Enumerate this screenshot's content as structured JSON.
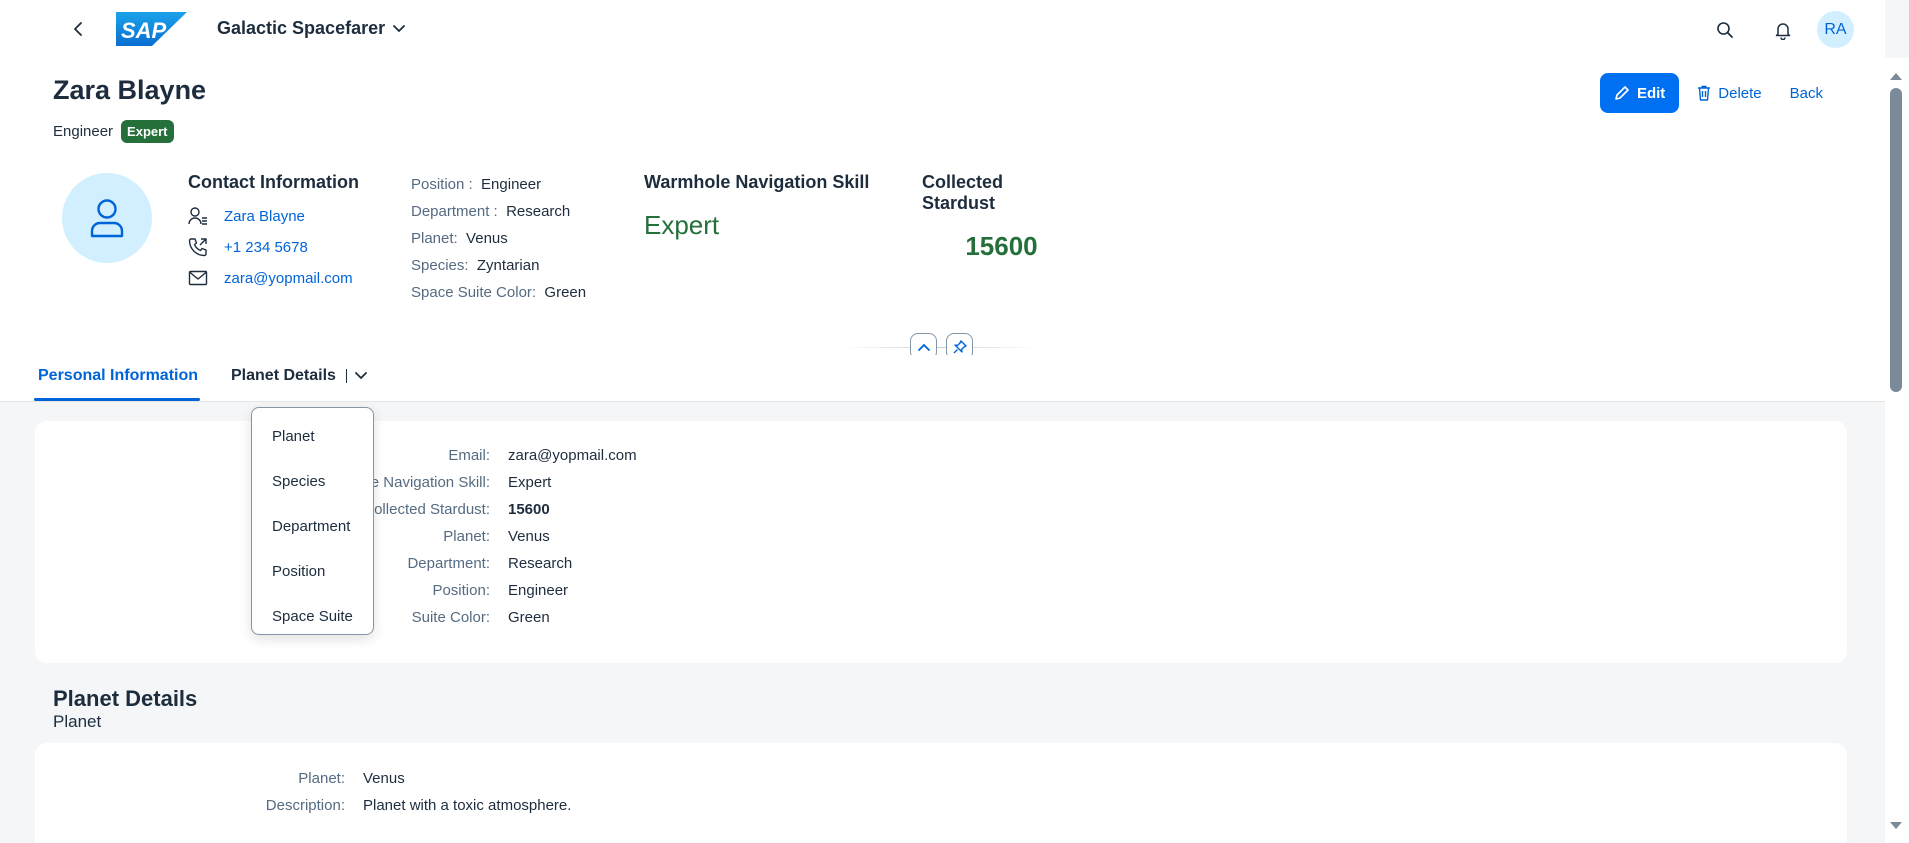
{
  "shell": {
    "app_title": "Galactic Spacefarer",
    "logo_text": "SAP",
    "user_initials": "RA"
  },
  "header": {
    "title": "Zara Blayne",
    "subtitle": "Engineer",
    "badge": "Expert",
    "actions": {
      "edit": "Edit",
      "delete": "Delete",
      "back": "Back"
    }
  },
  "contact": {
    "heading": "Contact Information",
    "name": "Zara Blayne",
    "phone": "+1 234 5678",
    "email": "zara@yopmail.com"
  },
  "attributes": [
    {
      "label": "Position :",
      "value": "Engineer"
    },
    {
      "label": "Department :",
      "value": "Research"
    },
    {
      "label": "Planet:",
      "value": "Venus"
    },
    {
      "label": "Species:",
      "value": "Zyntarian"
    },
    {
      "label": "Space Suite Color:",
      "value": "Green"
    }
  ],
  "kpis": {
    "skill_title": "Warmhole Navigation Skill",
    "skill_value": "Expert",
    "stardust_title": "Collected Stardust",
    "stardust_value": "15600"
  },
  "tabs": [
    {
      "label": "Personal Information"
    },
    {
      "label": "Planet Details"
    }
  ],
  "dropdown": [
    "Planet",
    "Species",
    "Department",
    "Position",
    "Space Suite"
  ],
  "personal_form": [
    {
      "label": "Email:",
      "value": "zara@yopmail.com"
    },
    {
      "label": "e Navigation Skill:",
      "value": "Expert"
    },
    {
      "label": "ollected Stardust:",
      "value": "15600"
    },
    {
      "label": "Planet:",
      "value": "Venus"
    },
    {
      "label": "Department:",
      "value": "Research"
    },
    {
      "label": "Position:",
      "value": "Engineer"
    },
    {
      "label": "Suite Color:",
      "value": "Green"
    }
  ],
  "planet_section": {
    "title": "Planet Details",
    "subtitle": "Planet",
    "fields": [
      {
        "label": "Planet:",
        "value": "Venus"
      },
      {
        "label": "Description:",
        "value": "Planet with a toxic atmosphere."
      }
    ]
  },
  "colors": {
    "brand": "#0070f2",
    "link": "#0064d9",
    "positive": "#256f3a",
    "avatar_bg": "#d1efff"
  }
}
